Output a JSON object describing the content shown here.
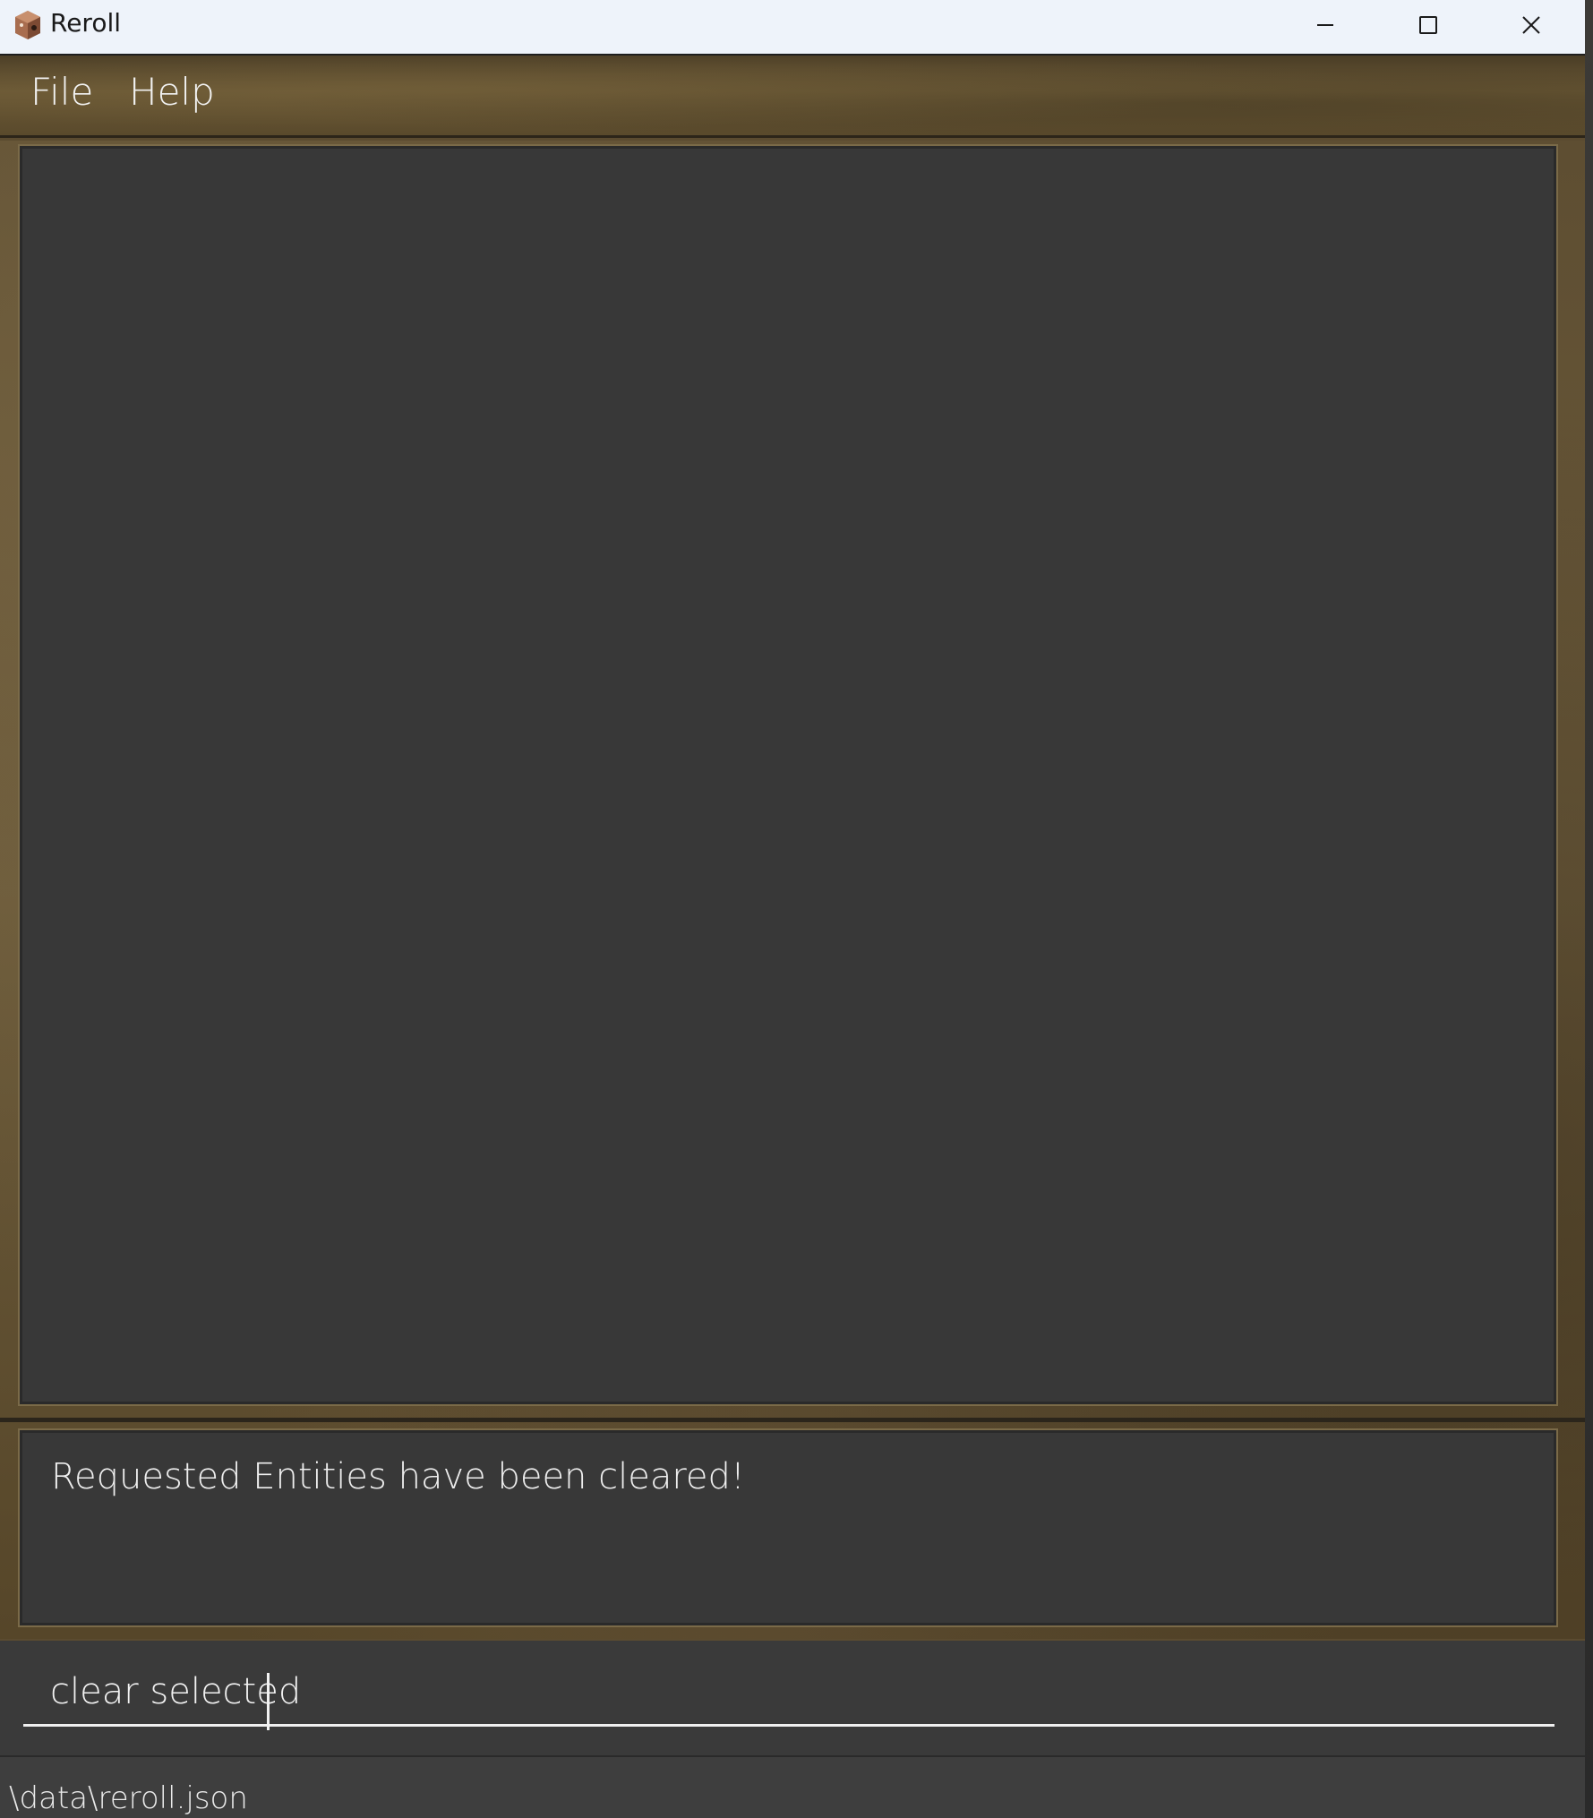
{
  "window": {
    "title": "Reroll",
    "icon": "dice-cube-icon"
  },
  "menubar": {
    "items": [
      {
        "label": "File"
      },
      {
        "label": "Help"
      }
    ]
  },
  "list_panel": {
    "items": []
  },
  "result_display": {
    "message": "Requested Entities have been cleared!"
  },
  "command_box": {
    "value": "clear selected",
    "placeholder": ""
  },
  "status_bar": {
    "path": "\\data\\reroll.json"
  },
  "colors": {
    "panel": "#383838",
    "frame": "#5e4e32",
    "text": "#f2f2f2",
    "titlebar": "#eef3fa"
  }
}
